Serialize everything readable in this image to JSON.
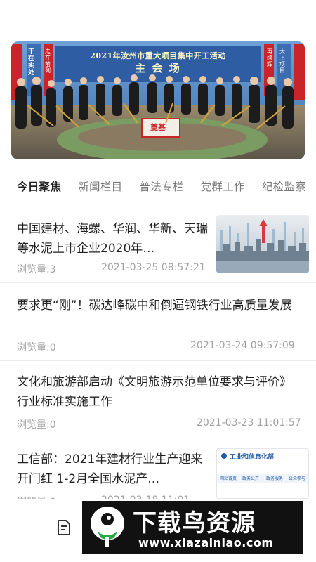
{
  "banner": {
    "title": "2021年汝州市重大项目集中开工活动",
    "subtitle": "主 会 场",
    "left_signs": [
      "干在实处",
      "走在前列"
    ],
    "right_signs": [
      "大上项目",
      "再续辉"
    ],
    "sign_text": "奠基"
  },
  "tabs": [
    {
      "label": "今日聚焦",
      "active": true
    },
    {
      "label": "新闻栏目",
      "active": false
    },
    {
      "label": "普法专栏",
      "active": false
    },
    {
      "label": "党群工作",
      "active": false
    },
    {
      "label": "纪检监察",
      "active": false
    }
  ],
  "news": [
    {
      "title": "中国建材、海螺、华润、华新、天瑞等水泥上市企业2020年…",
      "views": "浏览量:3",
      "date": "2021-03-25 08:57:21",
      "thumb": "skyline-chart"
    },
    {
      "title": "要求更“刚”！碳达峰碳中和倒逼钢铁行业高质量发展",
      "views": "浏览量:0",
      "date": "2021-03-24 09:57:09"
    },
    {
      "title": "文化和旅游部启动《文明旅游示范单位要求与评价》行业标准实施工作",
      "views": "浏览量:0",
      "date": "2021-03-23 11:01:57"
    },
    {
      "title": "工信部：2021年建材行业生产迎来开门红 1-2月全国水泥产…",
      "views": "浏览量:0",
      "date": "2021-03-18 11:01",
      "thumb": "miit-website",
      "thumb_header": "工业和信息化部",
      "thumb_tabs": [
        "网站首页",
        "政务公开",
        "政务服务",
        "公众参与"
      ]
    }
  ],
  "bottom_bar": {
    "icon": "document-icon"
  },
  "watermark": {
    "big": "下载鸟资源",
    "small": "www.xiazainiao.com"
  },
  "colors": {
    "accent": "#222222",
    "muted": "#a0a0a0",
    "banner_blue": "#5a86b8",
    "banner_red": "#c8242a"
  }
}
